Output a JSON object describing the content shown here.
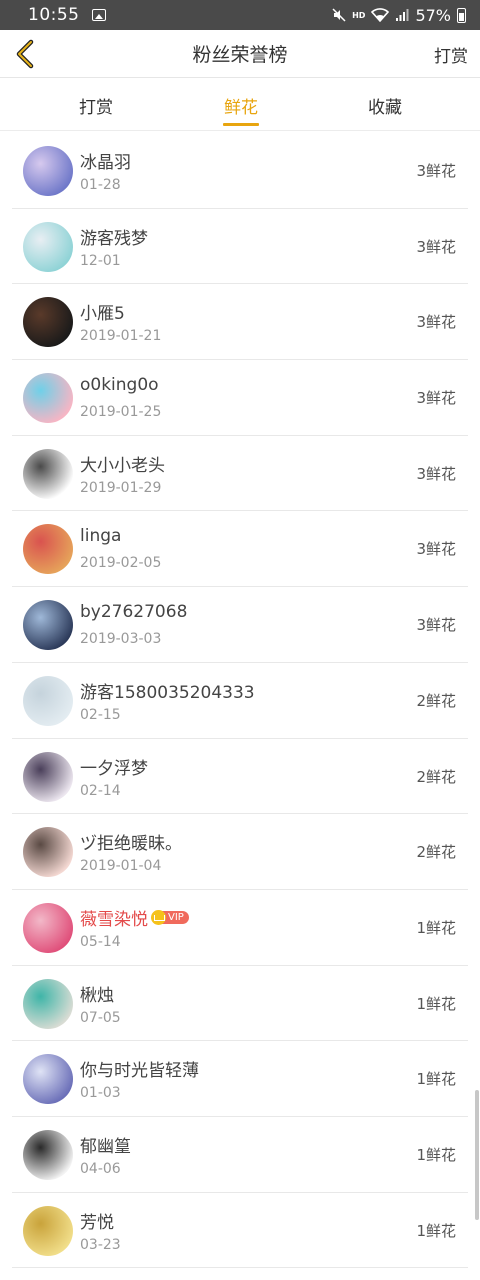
{
  "status_bar": {
    "time": "10:55",
    "hd": "HD",
    "battery": "57%"
  },
  "nav": {
    "title": "粉丝荣誉榜",
    "right_action": "打赏"
  },
  "tabs": [
    {
      "label": "打赏",
      "active": false
    },
    {
      "label": "鲜花",
      "active": true
    },
    {
      "label": "收藏",
      "active": false
    }
  ],
  "fans": [
    {
      "name": "冰晶羽",
      "date": "01-28",
      "count": "3鲜花",
      "vip": false,
      "avatar_colors": [
        "#6f78c9",
        "#d6c9ee"
      ]
    },
    {
      "name": "游客残梦",
      "date": "12-01",
      "count": "3鲜花",
      "vip": false,
      "avatar_colors": [
        "#8fd3d6",
        "#e8eef3"
      ]
    },
    {
      "name": "小雁5",
      "date": "2019-01-21",
      "count": "3鲜花",
      "vip": false,
      "avatar_colors": [
        "#1a1a1a",
        "#5a3a2a"
      ]
    },
    {
      "name": "o0king0o",
      "date": "2019-01-25",
      "count": "3鲜花",
      "vip": false,
      "avatar_colors": [
        "#f7b5c4",
        "#6fd0e8"
      ]
    },
    {
      "name": "大小小老头",
      "date": "2019-01-29",
      "count": "3鲜花",
      "vip": false,
      "avatar_colors": [
        "#ffffff",
        "#4a4a4a"
      ]
    },
    {
      "name": "linga",
      "date": "2019-02-05",
      "count": "3鲜花",
      "vip": false,
      "avatar_colors": [
        "#e6a35a",
        "#d9534f"
      ]
    },
    {
      "name": "by27627068",
      "date": "2019-03-03",
      "count": "3鲜花",
      "vip": false,
      "avatar_colors": [
        "#2c3a5a",
        "#9fb8d8"
      ]
    },
    {
      "name": "游客1580035204333",
      "date": "02-15",
      "count": "2鲜花",
      "vip": false,
      "avatar_colors": [
        "#e3ecf1",
        "#c5d3dc"
      ]
    },
    {
      "name": "一夕浮梦",
      "date": "02-14",
      "count": "2鲜花",
      "vip": false,
      "avatar_colors": [
        "#ece6ef",
        "#4a3f5a"
      ]
    },
    {
      "name": "ヅ拒绝暖昧。",
      "date": "2019-01-04",
      "count": "2鲜花",
      "vip": false,
      "avatar_colors": [
        "#f4d8d2",
        "#5a4a44"
      ]
    },
    {
      "name": "薇雪染悦",
      "date": "05-14",
      "count": "1鲜花",
      "vip": true,
      "vip_label": "VIP",
      "avatar_colors": [
        "#e04f7a",
        "#f2b8c8"
      ]
    },
    {
      "name": "楸烛",
      "date": "07-05",
      "count": "1鲜花",
      "vip": false,
      "avatar_colors": [
        "#d9dcd4",
        "#3fb5a8"
      ]
    },
    {
      "name": "你与时光皆轻薄",
      "date": "01-03",
      "count": "1鲜花",
      "vip": false,
      "avatar_colors": [
        "#6b6fb8",
        "#dfe3f5"
      ]
    },
    {
      "name": "郁幽篁",
      "date": "04-06",
      "count": "1鲜花",
      "vip": false,
      "avatar_colors": [
        "#f2f2f2",
        "#2a2a2a"
      ]
    },
    {
      "name": "芳悦",
      "date": "03-23",
      "count": "1鲜花",
      "vip": false,
      "avatar_colors": [
        "#f1de8a",
        "#c9a33b"
      ]
    }
  ],
  "colors": {
    "accent": "#e8a50f",
    "status_bar": "#4a4a4a",
    "vip_name": "#e34a4a"
  }
}
